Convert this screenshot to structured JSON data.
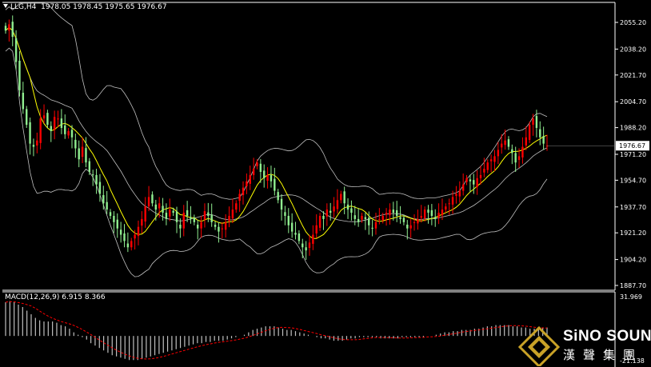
{
  "header": {
    "symbol": "LLG,H4",
    "ohlc": "1978.05 1978.45 1975.65 1976.67"
  },
  "macd_header": "MACD(12,26,9) 6.915 8.366",
  "price_axis": {
    "ticks": [
      "2055.20",
      "2038.20",
      "2021.70",
      "2004.70",
      "1988.20",
      "1971.20",
      "1954.70",
      "1937.70",
      "1921.20",
      "1904.20",
      "1887.70"
    ],
    "current_price": "1976.67"
  },
  "macd_axis": {
    "top": "31.969",
    "bottom": "-21.138"
  },
  "logo": {
    "en": "SiNO SOUND",
    "cn": "漢聲集團"
  },
  "colors": {
    "up": "#ff0000",
    "down": "#90ee90",
    "ma": "#ffff00",
    "bands": "#c0c0c0",
    "hist": "#c0c0c0",
    "signal": "#ff0000",
    "logo_gold": "#c9a227"
  },
  "chart_data": {
    "type": "candlestick",
    "price_range": [
      1887.7,
      2064
    ],
    "price_ticks": [
      2055.2,
      2038.2,
      2021.7,
      2004.7,
      1988.2,
      1971.2,
      1954.7,
      1937.7,
      1921.2,
      1904.2,
      1887.7
    ],
    "last_price": 1976.67,
    "indicators": [
      "Bollinger Bands",
      "Moving Average",
      "MACD(12,26,9)"
    ],
    "close": [
      2050,
      2054,
      2046,
      2030,
      2012,
      2000,
      1990,
      1978,
      1976,
      1980,
      1994,
      1996,
      1990,
      1986,
      1995,
      1994,
      1988,
      1984,
      1986,
      1982,
      1975,
      1968,
      1976,
      1966,
      1960,
      1958,
      1952,
      1946,
      1940,
      1936,
      1932,
      1928,
      1924,
      1920,
      1916,
      1912,
      1916,
      1920,
      1925,
      1930,
      1938,
      1944,
      1940,
      1936,
      1940,
      1934,
      1930,
      1936,
      1934,
      1928,
      1924,
      1934,
      1932,
      1930,
      1928,
      1924,
      1928,
      1935,
      1932,
      1928,
      1925,
      1922,
      1924,
      1928,
      1932,
      1936,
      1940,
      1946,
      1950,
      1954,
      1958,
      1962,
      1966,
      1960,
      1956,
      1958,
      1954,
      1948,
      1942,
      1936,
      1932,
      1926,
      1922,
      1920,
      1916,
      1912,
      1910,
      1915,
      1920,
      1926,
      1932,
      1930,
      1936,
      1934,
      1938,
      1942,
      1946,
      1940,
      1936,
      1934,
      1930,
      1928,
      1932,
      1930,
      1926,
      1924,
      1928,
      1930,
      1932,
      1934,
      1936,
      1934,
      1932,
      1930,
      1928,
      1924,
      1926,
      1928,
      1930,
      1932,
      1936,
      1934,
      1932,
      1930,
      1934,
      1936,
      1938,
      1940,
      1944,
      1946,
      1948,
      1952,
      1956,
      1954,
      1952,
      1956,
      1958,
      1962,
      1966,
      1968,
      1970,
      1974,
      1978,
      1980,
      1976,
      1972,
      1966,
      1970,
      1976,
      1982,
      1990,
      1994,
      1988,
      1982,
      1978,
      1976.67
    ],
    "macd_range": [
      -21.138,
      31.969
    ],
    "macd_hist": [
      28,
      29,
      28,
      26,
      24,
      21,
      18,
      15,
      13,
      12,
      12,
      12,
      11,
      9,
      8,
      6,
      3,
      1,
      -1,
      -3,
      -6,
      -8,
      -10,
      -12,
      -14,
      -16,
      -17,
      -18,
      -19,
      -20,
      -20,
      -20,
      -19,
      -18,
      -17,
      -16,
      -15,
      -14,
      -13,
      -12,
      -11,
      -10,
      -9,
      -8,
      -7,
      -6,
      -6,
      -5,
      -5,
      -4,
      -4,
      -4,
      -3,
      -2,
      -1,
      0,
      1,
      3,
      5,
      6,
      7,
      8,
      8,
      8,
      7,
      6,
      5,
      5,
      4,
      3,
      2,
      1,
      0,
      -1,
      -2,
      -2,
      -3,
      -4,
      -4,
      -4,
      -3,
      -2,
      -2,
      -1,
      -1,
      -1,
      -1,
      -1,
      -2,
      -2,
      -2,
      -2,
      -2,
      -1,
      -1,
      -1,
      -1,
      -1,
      -1,
      0,
      0,
      1,
      2,
      3,
      3,
      4,
      4,
      5,
      5,
      5,
      6,
      6,
      7,
      8,
      8,
      9,
      9,
      9,
      9,
      8,
      8,
      7,
      7,
      6,
      6,
      6,
      7,
      7
    ]
  }
}
